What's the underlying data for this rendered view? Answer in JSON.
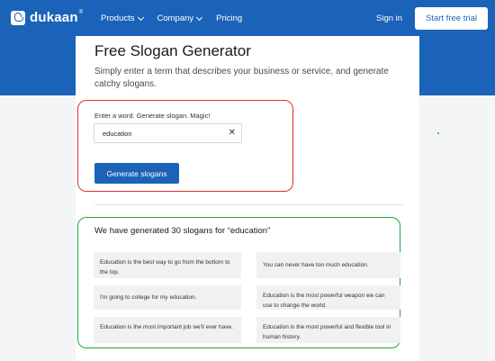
{
  "nav": {
    "logo_text": "dukaan",
    "logo_reg": "®",
    "menu": [
      {
        "label": "Products"
      },
      {
        "label": "Company"
      },
      {
        "label": "Pricing"
      }
    ],
    "signin": "Sign in",
    "trial": "Start free trial"
  },
  "main": {
    "title": "Free Slogan Generator",
    "subtitle": "Simply enter a term that describes your business or service, and generate catchy slogans.",
    "prompt": "Enter a word. Generate slogan. Magic!",
    "input_value": "education",
    "clear": "✕",
    "generate_label": "Generate slogans",
    "results_heading": "We have generated 30 slogans for “education”"
  },
  "slogans": [
    "Education is the best way to go from the bottom to the top.",
    "You can never have too much education.",
    "I'm going to college for my education.",
    "Education is the most powerful weapon we can use to change the world.",
    "Education is the most important job we'll ever have.",
    "Education is the most powerful and flexible tool in human history."
  ],
  "colors": {
    "brand": "#1a63b8",
    "highlight_red": "#e03030",
    "highlight_green": "#22a83a"
  }
}
